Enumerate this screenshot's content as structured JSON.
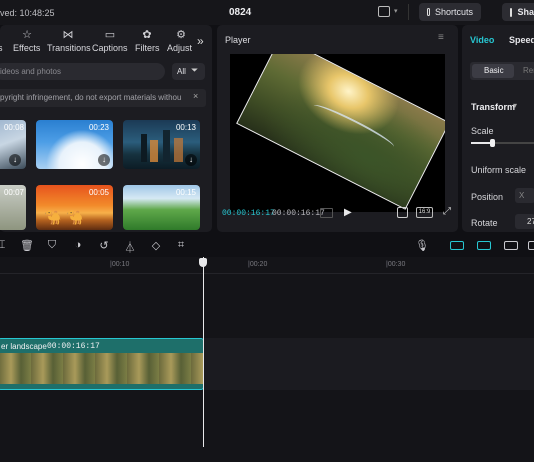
{
  "topbar": {
    "autosave_text": "ved: 10:48:25",
    "project_name": "0824",
    "shortcuts_label": "Shortcuts",
    "share_label": "Sha"
  },
  "media": {
    "tabs": [
      {
        "label": "s",
        "icon": "partial-icon"
      },
      {
        "label": "Effects",
        "icon": "effects-star-icon"
      },
      {
        "label": "Transitions",
        "icon": "transitions-icon"
      },
      {
        "label": "Captions",
        "icon": "captions-icon"
      },
      {
        "label": "Filters",
        "icon": "filters-icon"
      },
      {
        "label": "Adjust",
        "icon": "adjust-icon"
      }
    ],
    "search_placeholder": "ideos and photos",
    "filter_label": "All",
    "notice": "pyright infringement, do not export materials withou",
    "thumbs": [
      {
        "duration": "00:08",
        "kind": "partial-clip"
      },
      {
        "duration": "00:23",
        "kind": "sky-clouds"
      },
      {
        "duration": "00:13",
        "kind": "city-night"
      },
      {
        "duration": "00:07",
        "kind": "grass-field"
      },
      {
        "duration": "00:05",
        "kind": "camels-sunset"
      },
      {
        "duration": "00:15",
        "kind": "green-hills"
      }
    ]
  },
  "player": {
    "title": "Player",
    "current_time": "00:00:16:17",
    "total_time": "00:00:16:17",
    "ratio_label": "16:9"
  },
  "properties": {
    "tabs": [
      "Video",
      "Speed"
    ],
    "subtabs": [
      "Basic",
      "Rem"
    ],
    "section_title": "Transform",
    "scale_label": "Scale",
    "scale_fraction": 0.33,
    "uniform_scale_label": "Uniform scale",
    "position_label": "Position",
    "position_x_label": "X",
    "rotate_label": "Rotate",
    "rotate_value": "27"
  },
  "timeline": {
    "ruler_labels": [
      "|00:10",
      "|00:20",
      "|00:30"
    ],
    "clip_name": "er landscape",
    "clip_duration": "00:00:16:17"
  },
  "colors": {
    "accent": "#27c7d2",
    "clip_bg": "#1e6f6a",
    "playhead": "#e8e8ea"
  }
}
